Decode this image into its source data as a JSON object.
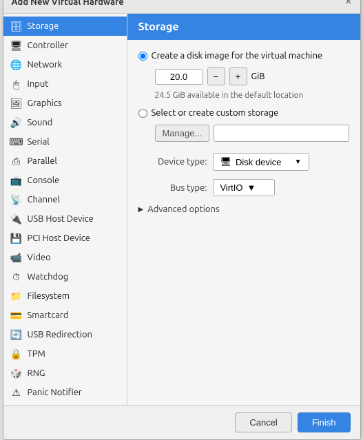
{
  "dialog": {
    "title": "Add New Virtual Hardware",
    "close_label": "×"
  },
  "sidebar": {
    "items": [
      {
        "id": "storage",
        "label": "Storage",
        "icon": "🗄",
        "active": true
      },
      {
        "id": "controller",
        "label": "Controller",
        "icon": "🖥"
      },
      {
        "id": "network",
        "label": "Network",
        "icon": "🌐"
      },
      {
        "id": "input",
        "label": "Input",
        "icon": "🖱"
      },
      {
        "id": "graphics",
        "label": "Graphics",
        "icon": "🖼"
      },
      {
        "id": "sound",
        "label": "Sound",
        "icon": "🔊"
      },
      {
        "id": "serial",
        "label": "Serial",
        "icon": "⌨"
      },
      {
        "id": "parallel",
        "label": "Parallel",
        "icon": "⎙"
      },
      {
        "id": "console",
        "label": "Console",
        "icon": "📺"
      },
      {
        "id": "channel",
        "label": "Channel",
        "icon": "📡"
      },
      {
        "id": "usb-host",
        "label": "USB Host Device",
        "icon": "🔌"
      },
      {
        "id": "pci-host",
        "label": "PCI Host Device",
        "icon": "💾"
      },
      {
        "id": "video",
        "label": "Video",
        "icon": "📹"
      },
      {
        "id": "watchdog",
        "label": "Watchdog",
        "icon": "⏱"
      },
      {
        "id": "filesystem",
        "label": "Filesystem",
        "icon": "📁"
      },
      {
        "id": "smartcard",
        "label": "Smartcard",
        "icon": "💳"
      },
      {
        "id": "usb-redir",
        "label": "USB Redirection",
        "icon": "🔄"
      },
      {
        "id": "tpm",
        "label": "TPM",
        "icon": "🔒"
      },
      {
        "id": "rng",
        "label": "RNG",
        "icon": "🎲"
      },
      {
        "id": "panic",
        "label": "Panic Notifier",
        "icon": "⚠"
      }
    ]
  },
  "main": {
    "panel_title": "Storage",
    "radio1_label": "Create a disk image for the virtual machine",
    "disk_size_value": "20.0",
    "disk_unit": "GiB",
    "available_text": "24.5 GiB available in the default location",
    "radio2_label": "Select or create custom storage",
    "manage_btn_label": "Manage...",
    "manage_placeholder": "",
    "device_type_label": "Device type:",
    "device_type_value": "Disk device",
    "bus_type_label": "Bus type:",
    "bus_type_value": "VirtIO",
    "advanced_label": "Advanced options",
    "minus_label": "−",
    "plus_label": "+"
  },
  "footer": {
    "cancel_label": "Cancel",
    "finish_label": "Finish"
  }
}
